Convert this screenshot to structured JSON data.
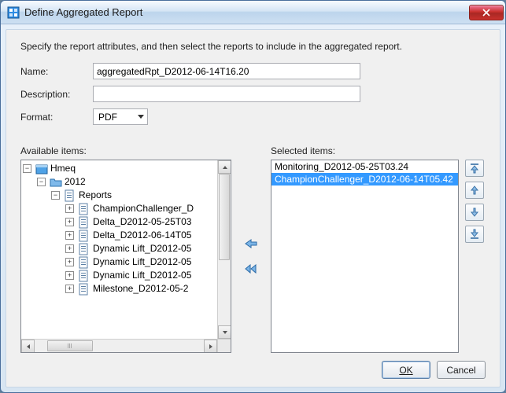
{
  "window": {
    "title": "Define Aggregated Report"
  },
  "intro": "Specify the report attributes, and then select the reports to include in the aggregated report.",
  "form": {
    "name_label": "Name:",
    "name_value": "aggregatedRpt_D2012-06-14T16.20",
    "desc_label": "Description:",
    "desc_value": "",
    "format_label": "Format:",
    "format_value": "PDF"
  },
  "available": {
    "label": "Available items:",
    "tree": {
      "root": "Hmeq",
      "year": "2012",
      "reports_label": "Reports",
      "items": [
        "ChampionChallenger_D",
        "Delta_D2012-05-25T03",
        "Delta_D2012-06-14T05",
        "Dynamic Lift_D2012-05",
        "Dynamic Lift_D2012-05",
        "Dynamic Lift_D2012-05",
        "Milestone_D2012-05-2"
      ]
    }
  },
  "selected": {
    "label": "Selected items:",
    "items": [
      {
        "text": "Monitoring_D2012-05-25T03.24",
        "selected": false
      },
      {
        "text": "ChampionChallenger_D2012-06-14T05.42",
        "selected": true
      }
    ]
  },
  "buttons": {
    "ok": "OK",
    "cancel": "Cancel"
  }
}
